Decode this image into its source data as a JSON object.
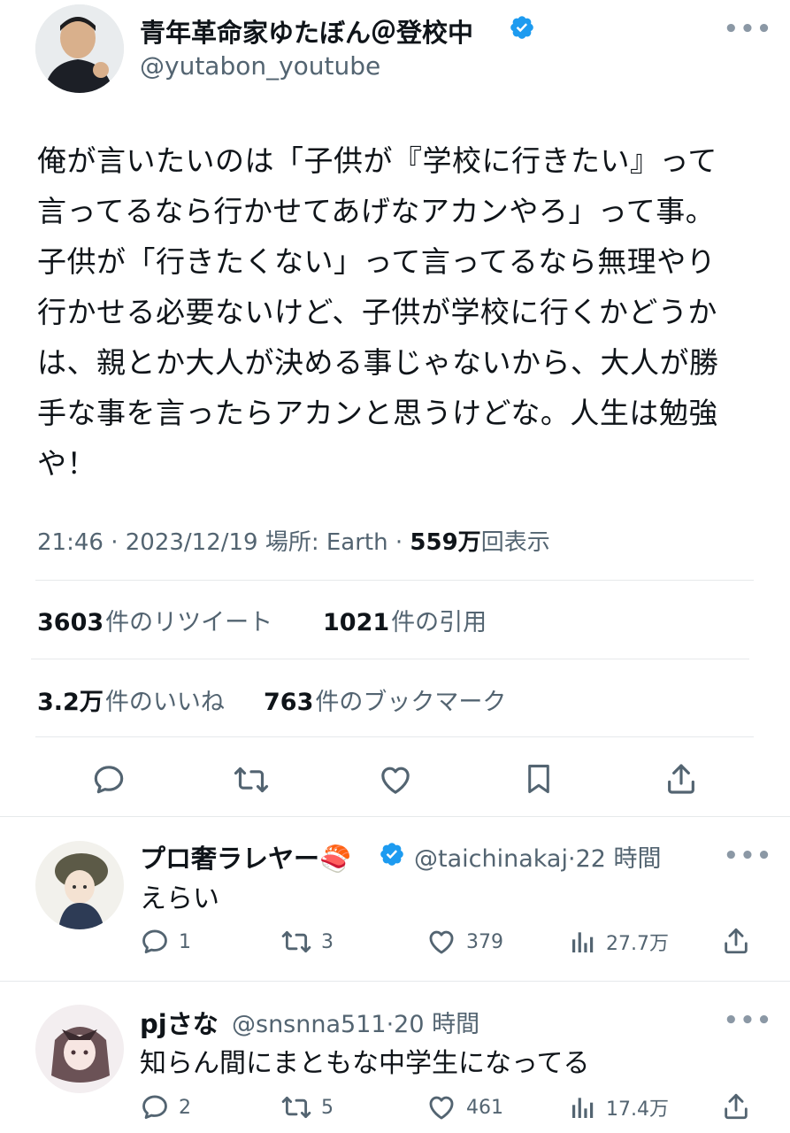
{
  "tweet": {
    "author_name": "青年革命家ゆたぼん＠登校中",
    "author_handle": "@yutabon_youtube",
    "more_icon": "more-horizontal-icon",
    "text_lines": [
      "俺が言いたいのは「子供が『学校に行きたい』って",
      "言ってるなら行かせてあげなアカンやろ」って事。",
      "子供が「行きたくない」って言ってるなら無理やり",
      "行かせる必要ないけど、子供が学校に行くかどうか",
      "は、親とか大人が決める事じゃないから、大人が勝",
      "手な事を言ったらアカンと思うけどな。人生は勉強",
      "や！"
    ],
    "time": "21:46",
    "date": "2023/12/19",
    "location_label": "場所: Earth",
    "views_count": "559万",
    "views_label": "回表示",
    "retweets_count": "3603",
    "retweets_label": "件のリツイート",
    "quotes_count": "1021",
    "quotes_label": "件の引用",
    "likes_count": "3.2万",
    "likes_label": "件のいいね",
    "bookmarks_count": "763",
    "bookmarks_label": "件のブックマーク"
  },
  "replies": [
    {
      "name": "プロ奢ラレヤー",
      "emoji": "🍣",
      "handle": "@taichinakaj",
      "time": "22 時間",
      "text": "えらい",
      "reply_count": "1",
      "retweet_count": "3",
      "like_count": "379",
      "view_count": "27.7万"
    },
    {
      "name": "pjさな",
      "handle": "@snsnna511",
      "time": "20 時間",
      "text": "知らん間にまともな中学生になってる",
      "reply_count": "2",
      "retweet_count": "5",
      "like_count": "461",
      "view_count": "17.4万"
    }
  ],
  "colors": {
    "verified": "#1d9bf0",
    "text_primary": "#0f1419",
    "text_secondary": "#536471"
  }
}
